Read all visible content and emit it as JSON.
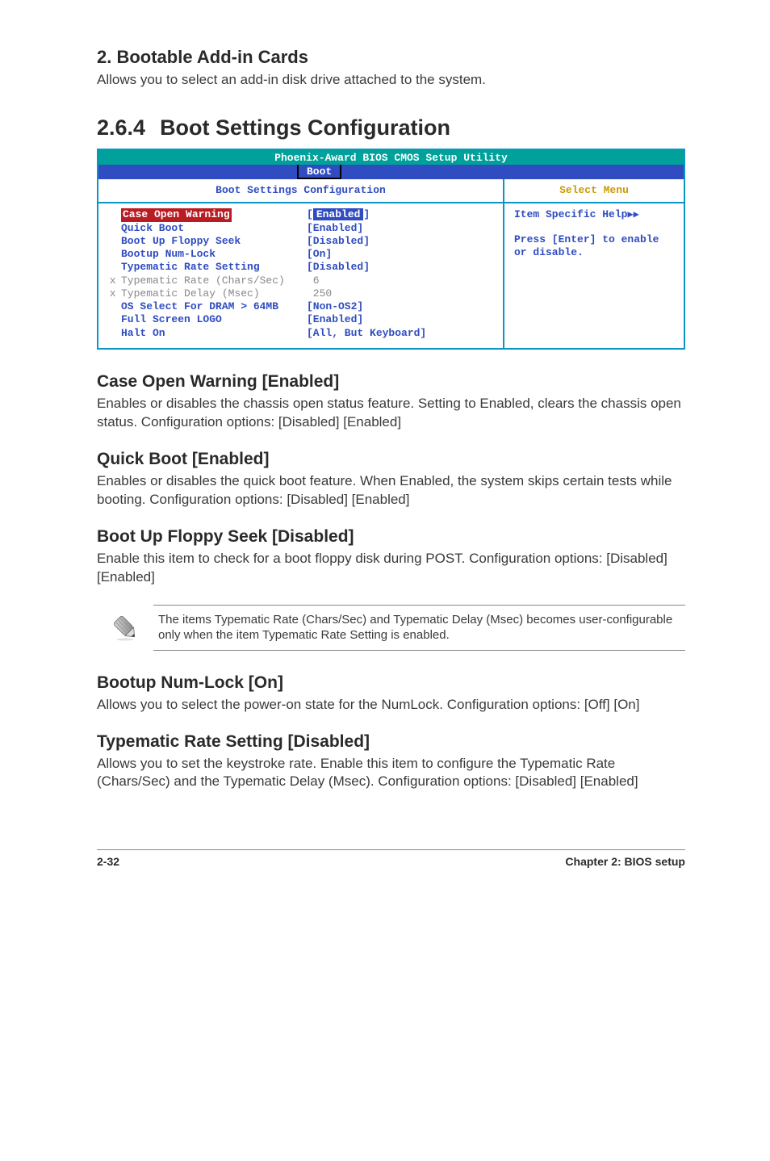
{
  "section2": {
    "title": "2. Bootable Add-in Cards",
    "text": "Allows you to select an add-in disk drive attached to the system."
  },
  "section264": {
    "number": "2.6.4",
    "title": "Boot Settings Configuration"
  },
  "bios": {
    "title": "Phoenix-Award BIOS CMOS Setup Utility",
    "tab": "Boot",
    "subtitle": "Boot Settings Configuration",
    "select_menu": "Select Menu",
    "help_title": "Item Specific Help",
    "help_arrows": "▶▶",
    "help_text": "Press [Enter] to enable or disable.",
    "rows": [
      {
        "marker": "",
        "label": "Case Open Warning",
        "value": "Enabled",
        "highlight": true,
        "gray": false
      },
      {
        "marker": "",
        "label": "Quick Boot",
        "value": "[Enabled]",
        "highlight": false,
        "gray": false
      },
      {
        "marker": "",
        "label": "Boot Up Floppy Seek",
        "value": "[Disabled]",
        "highlight": false,
        "gray": false
      },
      {
        "marker": "",
        "label": "Bootup Num-Lock",
        "value": "[On]",
        "highlight": false,
        "gray": false
      },
      {
        "marker": "",
        "label": "Typematic Rate Setting",
        "value": "[Disabled]",
        "highlight": false,
        "gray": false
      },
      {
        "marker": "x",
        "label": "Typematic Rate (Chars/Sec)",
        "value": " 6",
        "highlight": false,
        "gray": true
      },
      {
        "marker": "x",
        "label": "Typematic Delay (Msec)",
        "value": " 250",
        "highlight": false,
        "gray": true
      },
      {
        "marker": "",
        "label": "OS Select For DRAM > 64MB",
        "value": "[Non-OS2]",
        "highlight": false,
        "gray": false
      },
      {
        "marker": "",
        "label": "Full Screen LOGO",
        "value": "[Enabled]",
        "highlight": false,
        "gray": false
      },
      {
        "marker": "",
        "label": "Halt On",
        "value": "[All, But Keyboard]",
        "highlight": false,
        "gray": false
      }
    ]
  },
  "items": {
    "case_open": {
      "title": "Case Open Warning [Enabled]",
      "text": "Enables or disables the chassis open status feature. Setting to Enabled, clears the chassis open status. Configuration options: [Disabled] [Enabled]"
    },
    "quick_boot": {
      "title": "Quick Boot [Enabled]",
      "text": "Enables or disables the quick boot feature. When Enabled, the system skips certain tests while booting. Configuration options: [Disabled] [Enabled]"
    },
    "floppy_seek": {
      "title": "Boot Up Floppy Seek [Disabled]",
      "text": "Enable this item to check for a boot floppy disk during POST. Configuration options: [Disabled] [Enabled]"
    },
    "numlock": {
      "title": "Bootup Num-Lock [On]",
      "text": "Allows you to select the power-on state for the NumLock. Configuration options: [Off] [On]"
    },
    "typematic": {
      "title": "Typematic Rate Setting [Disabled]",
      "text": "Allows you to set the keystroke rate. Enable this item to configure the Typematic Rate (Chars/Sec) and the Typematic Delay (Msec). Configuration options: [Disabled] [Enabled]"
    }
  },
  "note": {
    "text": "The items Typematic Rate (Chars/Sec) and Typematic Delay (Msec) becomes user-configurable only when the item Typematic Rate Setting is enabled."
  },
  "footer": {
    "left": "2-32",
    "right": "Chapter 2: BIOS setup"
  }
}
